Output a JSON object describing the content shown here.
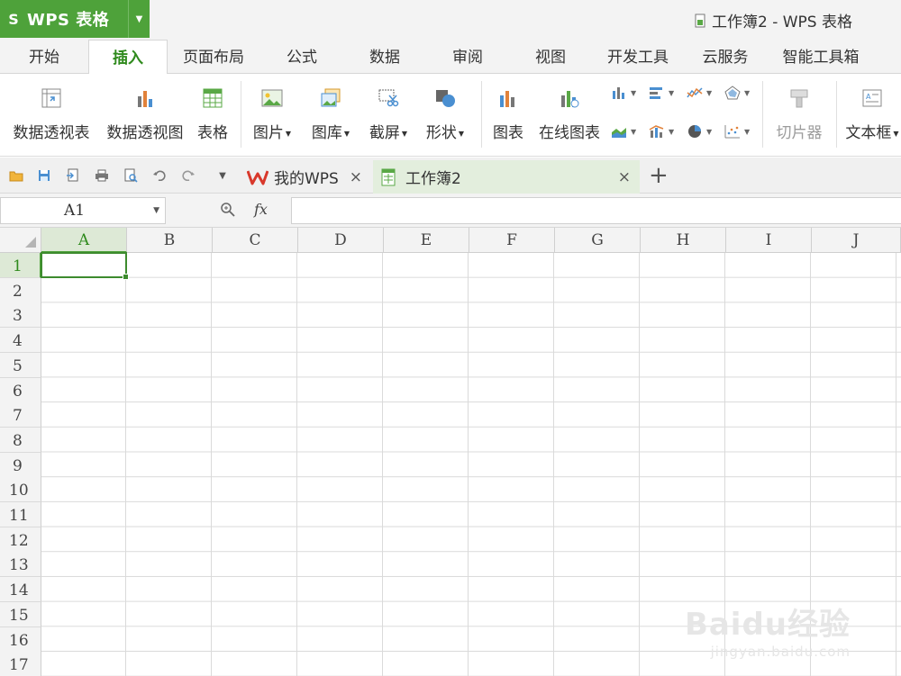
{
  "app": {
    "logo_glyph": "S",
    "name": "WPS 表格",
    "window_title": "工作簿2 - WPS 表格",
    "accent": "#4ea23a"
  },
  "ribbon_tabs": [
    "开始",
    "插入",
    "页面布局",
    "公式",
    "数据",
    "审阅",
    "视图",
    "开发工具",
    "云服务",
    "智能工具箱"
  ],
  "active_tab": "插入",
  "ribbon": {
    "pivot_table": "数据透视表",
    "pivot_chart": "数据透视图",
    "table": "表格",
    "picture": "图片",
    "gallery": "图库",
    "screenshot": "截屏",
    "shapes": "形状",
    "chart": "图表",
    "online_chart": "在线图表",
    "slicer": "切片器",
    "textbox": "文本框"
  },
  "doc_tabs": [
    {
      "label": "我的WPS",
      "icon": "wps-logo-icon"
    },
    {
      "label": "工作簿2",
      "icon": "spreadsheet-icon"
    }
  ],
  "formula_bar": {
    "name_box": "A1",
    "fx": "fx",
    "value": ""
  },
  "grid": {
    "columns": [
      "A",
      "B",
      "C",
      "D",
      "E",
      "F",
      "G",
      "H",
      "I",
      "J"
    ],
    "rows": [
      "1",
      "2",
      "3",
      "4",
      "5",
      "6",
      "7",
      "8",
      "9",
      "10",
      "11",
      "12",
      "13",
      "14",
      "15",
      "16",
      "17"
    ],
    "active_cell": "A1"
  },
  "watermark": {
    "brand": "Baidu经验",
    "url": "jingyan.baidu.com"
  }
}
